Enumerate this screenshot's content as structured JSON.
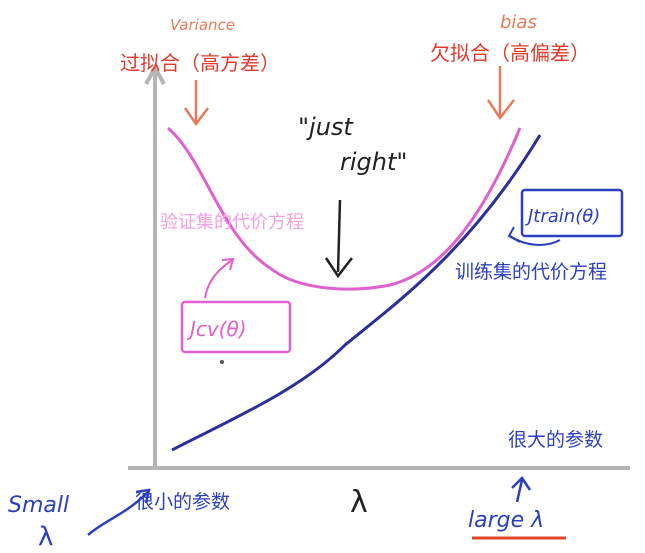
{
  "colors": {
    "axis": "#b5b5b5",
    "cv_curve": "#e060d0",
    "train_curve": "#2a2f9a",
    "red_annot": "#e03a2e",
    "orange_hand": "#e87a5a",
    "blue_annot": "#2b3fbf",
    "pink_annot": "#e060d0",
    "black_hand": "#222222",
    "underline": "#e0452a"
  },
  "labels": {
    "overfit": "过拟合（高方差）",
    "underfit": "欠拟合（高偏差）",
    "variance": "Variance",
    "bias": "bias",
    "just_right_line1": "\"just",
    "just_right_line2": "right\"",
    "cv_cost_cn": "验证集的代价方程",
    "train_cost_cn": "训练集的代价方程",
    "j_cv": "Jcv(θ)",
    "j_train": "Jtrain(θ)",
    "large_params": "很大的参数",
    "small_params": "很小的参数",
    "x_axis_label": "λ",
    "small_lambda_line1": "Small",
    "small_lambda_line2": "λ",
    "large_lambda": "large λ"
  }
}
